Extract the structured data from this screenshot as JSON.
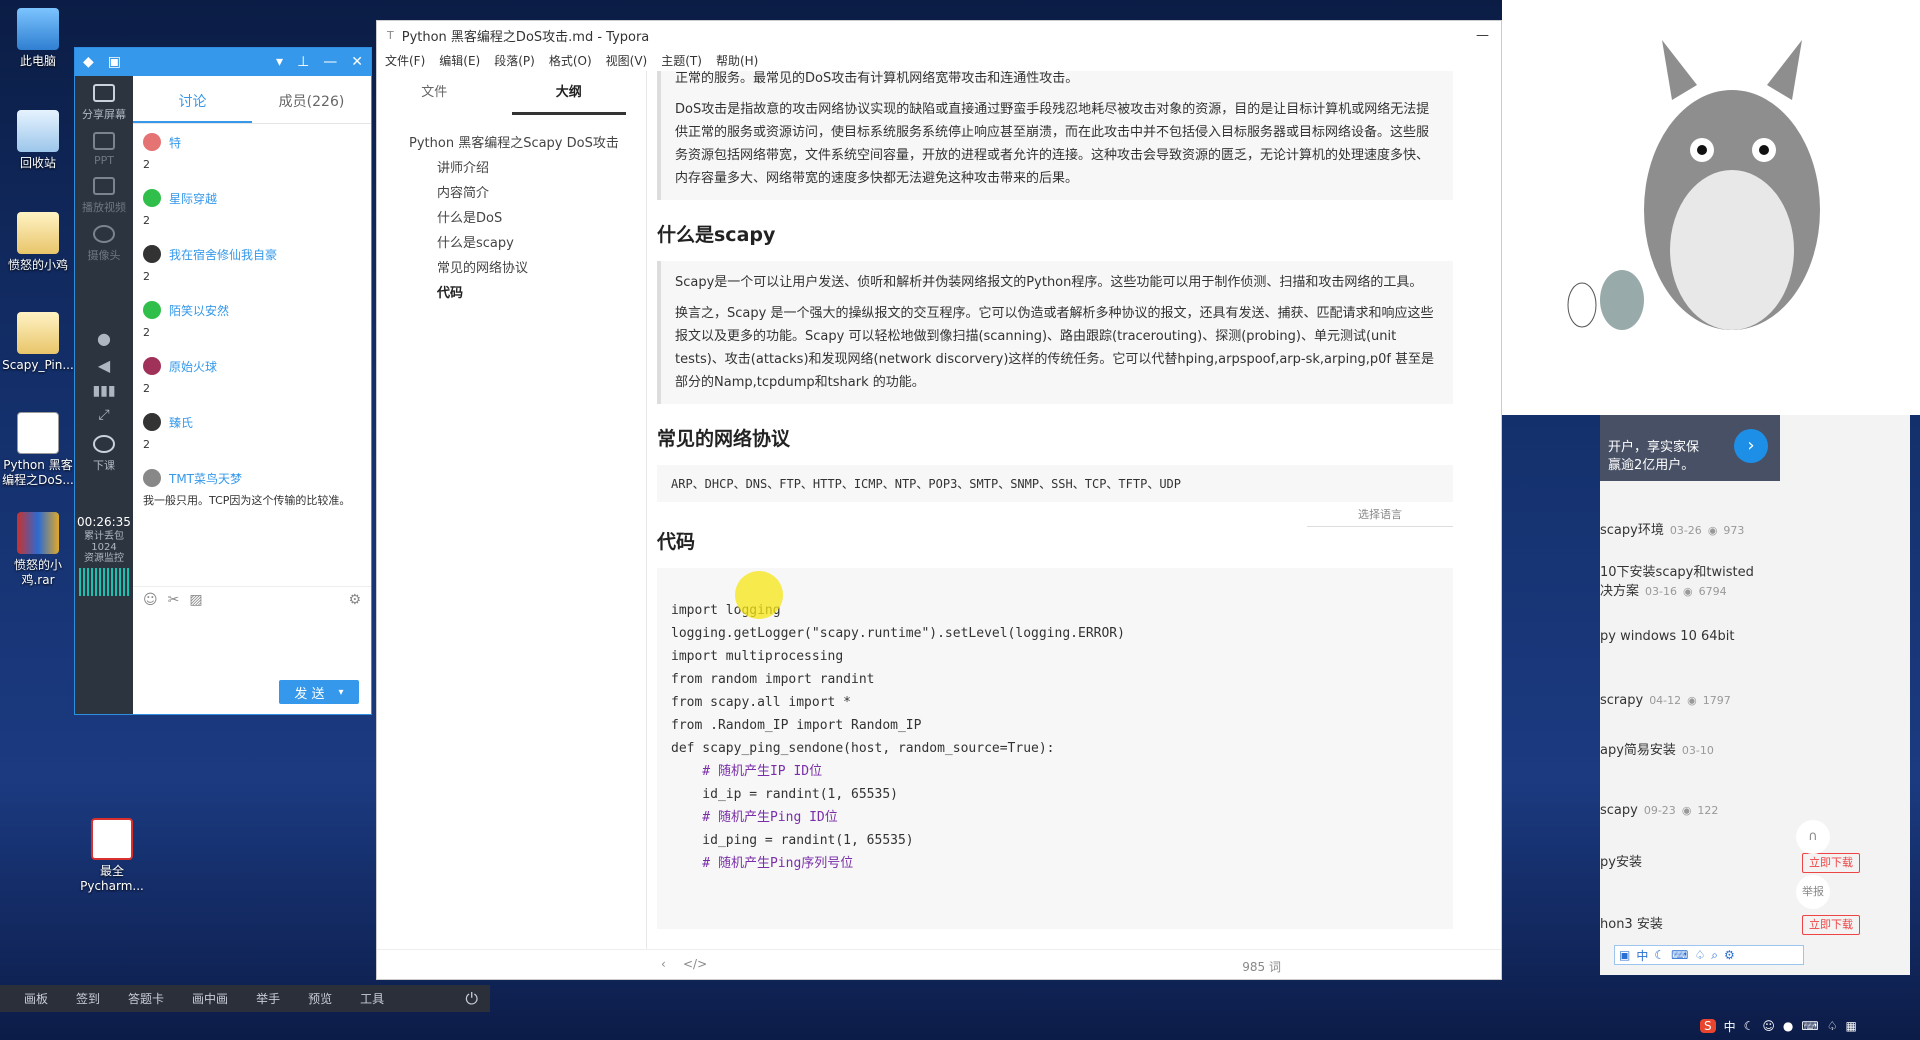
{
  "desktop": {
    "icons": [
      {
        "label": "此电脑"
      },
      {
        "label": "回收站"
      },
      {
        "label": "愤怒的小鸡"
      },
      {
        "label": "Scapy_Pin..."
      },
      {
        "label": "Python 黑客编程之DoS..."
      },
      {
        "label": "愤怒的小鸡.rar"
      },
      {
        "label": "最全Pycharm..."
      }
    ]
  },
  "chat": {
    "sidebar": [
      {
        "label": "分享屏幕"
      },
      {
        "label": "PPT"
      },
      {
        "label": "播放视频"
      },
      {
        "label": "摄像头"
      },
      {
        "label": "下课"
      }
    ],
    "timer": "00:26:35",
    "stats": "累计丢包\n1024\n资源监控",
    "tabs": [
      {
        "label": "讨论"
      },
      {
        "label": "成员(226)"
      }
    ],
    "messages": [
      {
        "user": "特",
        "text": "2",
        "color": "#e57373"
      },
      {
        "user": "星际穿越",
        "text": "2",
        "color": "#2fbf4a"
      },
      {
        "user": "我在宿舍修仙我自豪",
        "text": "2",
        "color": "#333"
      },
      {
        "user": "陌笑以安然",
        "text": "2",
        "color": "#2fbf4a"
      },
      {
        "user": "原始火球",
        "text": "2",
        "color": "#a0325a"
      },
      {
        "user": "臻氏",
        "text": "2",
        "color": "#333"
      },
      {
        "user": "TMT菜鸟天梦",
        "text": "我一般只用。TCP因为这个传输的比较准。",
        "color": "#666"
      }
    ],
    "send_label": "发 送"
  },
  "typora": {
    "title": "Python 黑客编程之DoS攻击.md - Typora",
    "menu": [
      "文件(F)",
      "编辑(E)",
      "段落(P)",
      "格式(O)",
      "视图(V)",
      "主题(T)",
      "帮助(H)"
    ],
    "side_tabs": [
      {
        "label": "文件"
      },
      {
        "label": "大纲"
      }
    ],
    "outline": {
      "root": "Python 黑客编程之Scapy DoS攻击",
      "items": [
        "讲师介绍",
        "内容简介",
        "什么是DoS",
        "什么是scapy",
        "常见的网络协议",
        "代码"
      ]
    },
    "doc": {
      "p0": "正常的服务。最常见的DoS攻击有计算机网络宽带攻击和连通性攻击。",
      "p1": "DoS攻击是指故意的攻击网络协议实现的缺陷或直接通过野蛮手段残忍地耗尽被攻击对象的资源，目的是让目标计算机或网络无法提供正常的服务或资源访问，使目标系统服务系统停止响应甚至崩溃，而在此攻击中并不包括侵入目标服务器或目标网络设备。这些服务资源包括网络带宽，文件系统空间容量，开放的进程或者允许的连接。这种攻击会导致资源的匮乏，无论计算机的处理速度多快、内存容量多大、网络带宽的速度多快都无法避免这种攻击带来的后果。",
      "h_scapy": "什么是scapy",
      "p2": "Scapy是一个可以让用户发送、侦听和解析并伪装网络报文的Python程序。这些功能可以用于制作侦测、扫描和攻击网络的工具。",
      "p3": "换言之，Scapy 是一个强大的操纵报文的交互程序。它可以伪造或者解析多种协议的报文，还具有发送、捕获、匹配请求和响应这些报文以及更多的功能。Scapy 可以轻松地做到像扫描(scanning)、路由跟踪(tracerouting)、探测(probing)、单元测试(unit tests)、攻击(attacks)和发现网络(network discorvery)这样的传统任务。它可以代替hping,arpspoof,arp-sk,arping,p0f 甚至是部分的Namp,tcpdump和tshark 的功能。",
      "h_proto": "常见的网络协议",
      "protocols": "ARP、DHCP、DNS、FTP、HTTP、ICMP、NTP、POP3、SMTP、SNMP、SSH、TCP、TFTP、UDP",
      "lang_select": "选择语言",
      "h_code": "代码",
      "code": [
        "import logging",
        "logging.getLogger(\"scapy.runtime\").setLevel(logging.ERROR)",
        "",
        "import multiprocessing",
        "from random import randint",
        "from scapy.all import *",
        "from .Random_IP import Random_IP",
        "",
        "",
        "def scapy_ping_sendone(host, random_source=True):",
        "    # 随机产生IP ID位",
        "    id_ip = randint(1, 65535)",
        "    # 随机产生Ping ID位",
        "    id_ping = randint(1, 65535)",
        "    # 随机产生Ping序列号位"
      ]
    },
    "word_count": "985 词"
  },
  "browser": {
    "ad": "开户，享实家保\n赢逾2亿用户。",
    "items": [
      {
        "title": "scapy环境",
        "date": "03-26",
        "views": "973"
      },
      {
        "title": "10下安装scapy和twisted\n决方案",
        "date": "03-16",
        "views": "6794"
      },
      {
        "title": "py windows 10 64bit",
        "date": "",
        "views": ""
      },
      {
        "title": "scrapy",
        "date": "04-12",
        "views": "1797"
      },
      {
        "title": "apy简易安装",
        "date": "03-10",
        "views": ""
      },
      {
        "title": "scapy",
        "date": "09-23",
        "views": "122"
      },
      {
        "title": "py安装",
        "date": "",
        "views": "",
        "dl": "立即下载"
      },
      {
        "title": "hon3 安装",
        "date": "",
        "views": "",
        "dl": "立即下载"
      }
    ],
    "report": "举报"
  },
  "taskbar": {
    "items": [
      "画板",
      "签到",
      "答题卡",
      "画中画",
      "举手",
      "预览",
      "工具"
    ]
  },
  "systray": {
    "ime": "中"
  }
}
